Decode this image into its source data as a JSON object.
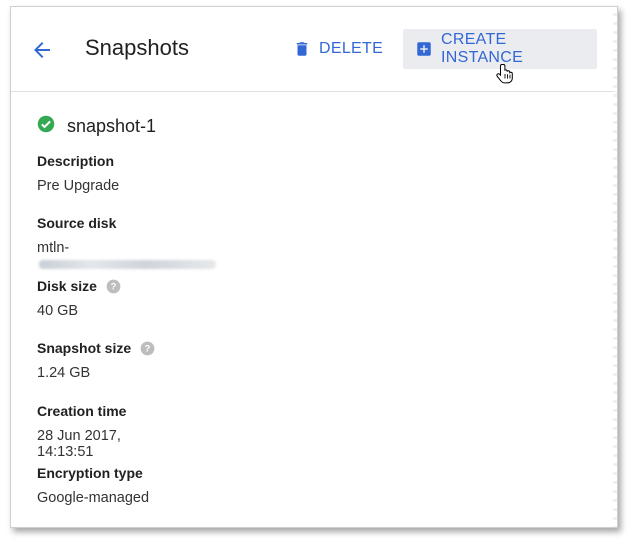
{
  "header": {
    "title": "Snapshots",
    "delete_label": "DELETE",
    "create_label": "CREATE INSTANCE"
  },
  "snapshot": {
    "name": "snapshot-1",
    "status": "ready",
    "status_color": "#34a853"
  },
  "fields": {
    "description": {
      "label": "Description",
      "value": "Pre Upgrade"
    },
    "source_disk": {
      "label": "Source disk",
      "value": "mtln-"
    },
    "disk_size": {
      "label": "Disk size",
      "value": "40 GB"
    },
    "snapshot_size": {
      "label": "Snapshot size",
      "value": "1.24 GB"
    },
    "creation_time": {
      "label": "Creation time",
      "value": "28 Jun 2017, 14:13:51"
    },
    "encryption_type": {
      "label": "Encryption type",
      "value": "Google-managed"
    }
  },
  "colors": {
    "accent": "#3367d6",
    "success": "#34a853",
    "help_icon": "#bdbdbd"
  },
  "icons": {
    "back": "arrow-back-icon",
    "delete": "trash-icon",
    "create": "add-box-icon",
    "status": "check-circle-icon",
    "help": "help-circle-icon",
    "cursor": "hand-pointer-icon"
  }
}
